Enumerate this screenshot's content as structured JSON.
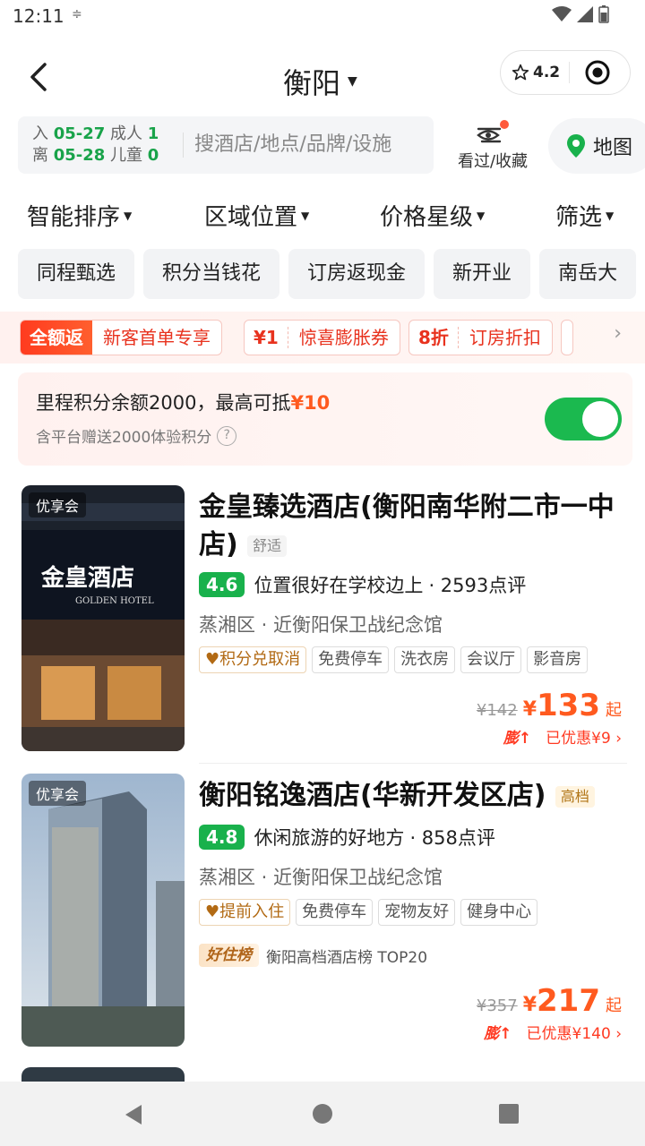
{
  "status_bar": {
    "time": "12:11",
    "extra": "≑"
  },
  "header": {
    "city": "衡阳",
    "rating": "4.2"
  },
  "search": {
    "checkin_label": "入",
    "checkin_date": "05-27",
    "checkout_label": "离",
    "checkout_date": "05-28",
    "adults_label": "成人",
    "adults": "1",
    "children_label": "儿童",
    "children": "0",
    "placeholder": "搜酒店/地点/品牌/设施",
    "seen_label": "看过/收藏",
    "map_label": "地图"
  },
  "sort": [
    "智能排序",
    "区域位置",
    "价格星级",
    "筛选"
  ],
  "quick_filters": [
    "同程甄选",
    "积分当钱花",
    "订房返现金",
    "新开业",
    "南岳大"
  ],
  "promos": [
    {
      "tag": "全额返",
      "text": "新客首单专享"
    },
    {
      "tag": "¥1",
      "text": "惊喜膨胀券"
    },
    {
      "tag": "8折",
      "text": "订房折扣"
    }
  ],
  "points": {
    "line1_prefix": "里程积分余额2000，最高可抵",
    "line1_amount": "¥10",
    "line2": "含平台赠送2000体验积分",
    "toggle_on": true
  },
  "hotels": [
    {
      "badge": "优享会",
      "name": "金皇臻选酒店(衡阳南华附二市一中店)",
      "grade": "舒适",
      "score": "4.6",
      "comment": "位置很好在学校边上",
      "reviews": "· 2593点评",
      "location": "蒸湘区 · 近衡阳保卫战纪念馆",
      "tags": [
        "积分兑取消",
        "免费停车",
        "洗衣房",
        "会议厅",
        "影音房"
      ],
      "photo_sign": "金皇酒店",
      "photo_sign_en": "GOLDEN HOTEL",
      "old_price": "¥142",
      "price": "133",
      "price_suffix": "起",
      "discount": "已优惠¥9",
      "boost": "膨"
    },
    {
      "badge": "优享会",
      "name": "衡阳铭逸酒店(华新开发区店)",
      "grade": "高档",
      "score": "4.8",
      "comment": "休闲旅游的好地方",
      "reviews": "· 858点评",
      "location": "蒸湘区 · 近衡阳保卫战纪念馆",
      "tags": [
        "提前入住",
        "免费停车",
        "宠物友好",
        "健身中心"
      ],
      "rank_tag": "好住榜",
      "rank_text": "衡阳高档酒店榜 TOP20",
      "old_price": "¥357",
      "price": "217",
      "price_suffix": "起",
      "discount": "已优惠¥140",
      "boost": "膨"
    }
  ],
  "colors": {
    "brand_green": "#19b14c",
    "price_orange": "#ff5a1f",
    "promo_red": "#e8321e"
  }
}
